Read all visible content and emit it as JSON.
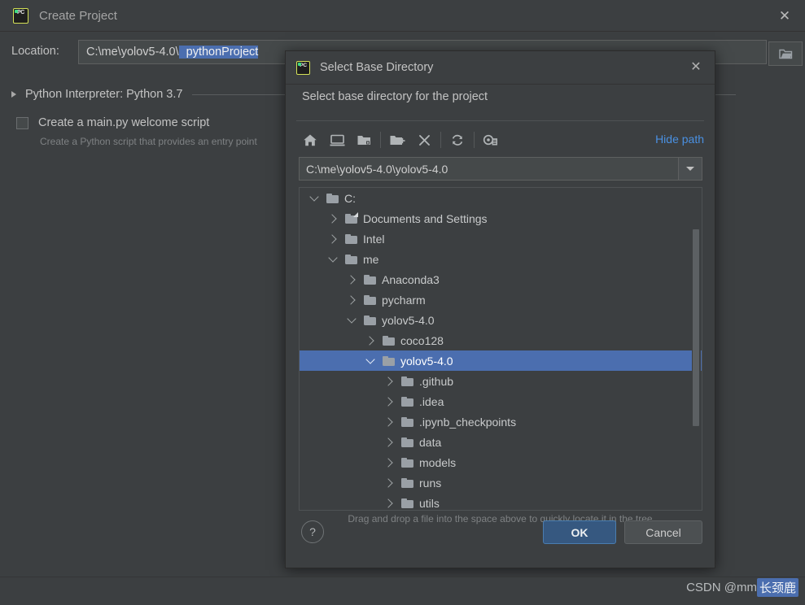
{
  "main_window": {
    "title": "Create Project",
    "app_icon": "pycharm-icon",
    "close_icon": "close-icon",
    "location": {
      "label": "Location:",
      "value_prefix": "C:\\me\\yolov5-4.0\\",
      "value_selected": "pythonProject",
      "browse_icon": "folder-icon"
    },
    "interpreter": {
      "expander_icon": "triangle-right-icon",
      "label": "Python Interpreter: Python 3.7"
    },
    "welcome_script": {
      "checked": false,
      "label": "Create a main.py welcome script",
      "description": "Create a Python script that provides an entry point"
    }
  },
  "dialog": {
    "title": "Select Base Directory",
    "app_icon": "pycharm-icon",
    "close_icon": "close-icon",
    "subtitle": "Select base directory for the project",
    "toolbar": {
      "buttons": [
        {
          "name": "home-icon",
          "tooltip": "Home"
        },
        {
          "name": "desktop-icon",
          "tooltip": "Desktop"
        },
        {
          "name": "folder-project-icon",
          "tooltip": "Project Directory"
        },
        {
          "name": "new-folder-icon",
          "tooltip": "New Folder"
        },
        {
          "name": "delete-icon",
          "tooltip": "Delete"
        },
        {
          "name": "refresh-icon",
          "tooltip": "Refresh"
        },
        {
          "name": "show-hidden-files-icon",
          "tooltip": "Show Hidden Files"
        }
      ],
      "hide_path_label": "Hide path"
    },
    "path_combo": {
      "value": "C:\\me\\yolov5-4.0\\yolov5-4.0",
      "dropdown_icon": "chevron-down-icon"
    },
    "tree": [
      {
        "label": "C:",
        "depth": 0,
        "state": "expanded",
        "icon": "folder-icon",
        "selected": false
      },
      {
        "label": "Documents and Settings",
        "depth": 1,
        "state": "collapsed",
        "icon": "folder-shortcut-icon",
        "selected": false
      },
      {
        "label": "Intel",
        "depth": 1,
        "state": "collapsed",
        "icon": "folder-icon",
        "selected": false
      },
      {
        "label": "me",
        "depth": 1,
        "state": "expanded",
        "icon": "folder-icon",
        "selected": false
      },
      {
        "label": "Anaconda3",
        "depth": 2,
        "state": "collapsed",
        "icon": "folder-icon",
        "selected": false
      },
      {
        "label": "pycharm",
        "depth": 2,
        "state": "collapsed",
        "icon": "folder-icon",
        "selected": false
      },
      {
        "label": "yolov5-4.0",
        "depth": 2,
        "state": "expanded",
        "icon": "folder-icon",
        "selected": false
      },
      {
        "label": "coco128",
        "depth": 3,
        "state": "collapsed",
        "icon": "folder-icon",
        "selected": false
      },
      {
        "label": "yolov5-4.0",
        "depth": 3,
        "state": "expanded",
        "icon": "folder-icon",
        "selected": true
      },
      {
        "label": ".github",
        "depth": 4,
        "state": "collapsed",
        "icon": "folder-icon",
        "selected": false
      },
      {
        "label": ".idea",
        "depth": 4,
        "state": "collapsed",
        "icon": "folder-icon",
        "selected": false
      },
      {
        "label": ".ipynb_checkpoints",
        "depth": 4,
        "state": "collapsed",
        "icon": "folder-icon",
        "selected": false
      },
      {
        "label": "data",
        "depth": 4,
        "state": "collapsed",
        "icon": "folder-icon",
        "selected": false
      },
      {
        "label": "models",
        "depth": 4,
        "state": "collapsed",
        "icon": "folder-icon",
        "selected": false
      },
      {
        "label": "runs",
        "depth": 4,
        "state": "collapsed",
        "icon": "folder-icon",
        "selected": false
      },
      {
        "label": "utils",
        "depth": 4,
        "state": "collapsed",
        "icon": "folder-icon",
        "selected": false
      },
      {
        "label": "",
        "depth": 4,
        "state": "collapsed",
        "icon": "folder-icon",
        "selected": false
      }
    ],
    "hint": "Drag and drop a file into the space above to quickly locate it in the tree",
    "help_label": "?",
    "ok_label": "OK",
    "cancel_label": "Cancel"
  },
  "watermark": {
    "prefix": "CSDN @mm",
    "highlight": "长颈鹿"
  },
  "colors": {
    "background": "#3c3f41",
    "selection_blue": "#4b6eaf",
    "link_blue": "#4a90e2",
    "ok_button": "#365880",
    "field_background": "#45494a"
  }
}
